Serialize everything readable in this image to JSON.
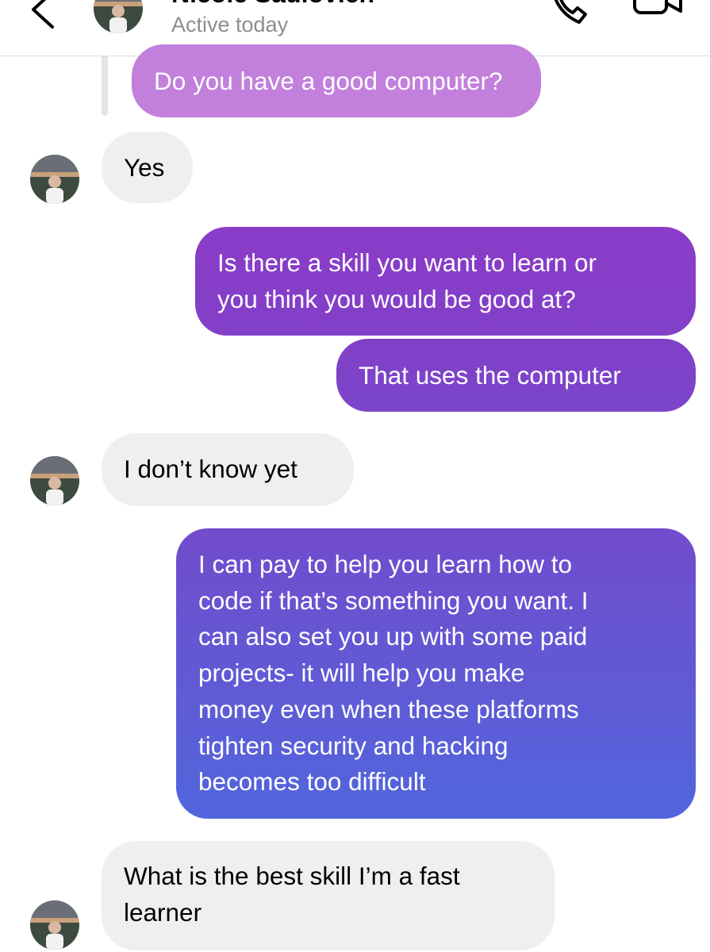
{
  "header": {
    "contact_name": "Nicole Sadlovich",
    "status": "Active today"
  },
  "conversation": {
    "quoted_message": "Do you have a good computer?",
    "messages": [
      {
        "sender": "them",
        "text": "Yes"
      },
      {
        "sender": "me",
        "lines": [
          "Is there a skill you want to learn or",
          "you think you would be good at?"
        ]
      },
      {
        "sender": "me",
        "text": "That uses the computer"
      },
      {
        "sender": "them",
        "text": "I don’t know yet"
      },
      {
        "sender": "me",
        "lines": [
          "I can pay to help you learn how to",
          "code if that’s something you want. I",
          "can also set you up with some paid",
          "projects- it will help you make",
          "money even when these platforms",
          "tighten security and hacking",
          "becomes too difficult"
        ]
      },
      {
        "sender": "them",
        "lines": [
          "What is the best skill I’m a fast",
          "learner"
        ]
      }
    ]
  },
  "colors": {
    "incoming_bubble": "#efefef",
    "quoted_bubble": "#c27fdc",
    "outgoing_gradient_top": "#8a3cc7",
    "outgoing_gradient_bottom": "#4f6ade",
    "secondary_text": "#8e8e8e"
  },
  "icons": {
    "back": "chevron-left-icon",
    "call": "phone-icon",
    "video": "video-camera-icon"
  }
}
